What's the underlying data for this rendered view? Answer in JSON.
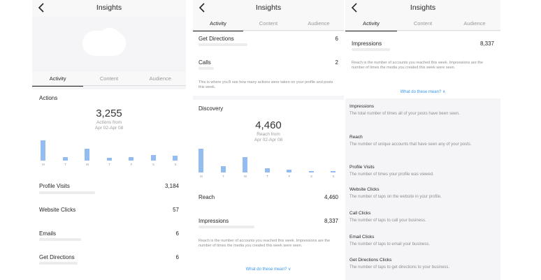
{
  "title": "Insights",
  "tabs": [
    "Activity",
    "Content",
    "Audience"
  ],
  "panel1": {
    "actions_heading": "Actions",
    "total": "3,255",
    "total_caption": "Actions from",
    "total_range": "Apr 02-Apr 08",
    "days": [
      "M",
      "T",
      "W",
      "T",
      "F",
      "S",
      "S"
    ],
    "bar_values": [
      0.95,
      0.15,
      0.55,
      0.13,
      0.16,
      0.28,
      0.23
    ],
    "rows": [
      {
        "label": "Profile Visits",
        "value": "3,184"
      },
      {
        "label": "Website Clicks",
        "value": "57"
      },
      {
        "label": "Emails",
        "value": "6"
      },
      {
        "label": "Get Directions",
        "value": "6"
      }
    ]
  },
  "panel2": {
    "rows_top": [
      {
        "label": "Get Directions",
        "value": "6"
      },
      {
        "label": "Calls",
        "value": "2"
      }
    ],
    "note": "This is where you'll see how many actions were taken on your profile and posts this week.",
    "discovery_heading": "Discovery",
    "total": "4,460",
    "total_caption": "Reach from",
    "total_range": "Apr 02-Apr 08",
    "days": [
      "M",
      "T",
      "W",
      "T",
      "F",
      "S",
      "S"
    ],
    "bar_values": [
      1.0,
      0.27,
      0.66,
      0.18,
      0.12,
      0.07,
      0.06
    ],
    "reach_label": "Reach",
    "reach_value": "4,460",
    "impressions_label": "Impressions",
    "impressions_value": "8,337",
    "footnote": "Reach is the number of accounts you reached this week. Impressions are the number of times the media you created this week were seen.",
    "link": "What do these mean? ∨"
  },
  "panel3": {
    "impressions_label": "Impressions",
    "impressions_value": "8,337",
    "footnote": "Reach is the number of accounts you reached this week. Impressions are the number of times the media you created this week were seen.",
    "link": "What do these mean? ∧",
    "definitions": [
      {
        "term": "Impressions",
        "desc": "The total number of times all of your posts have been seen."
      },
      {
        "term": "Reach",
        "desc": "The number of unique accounts that have seen any of your posts."
      },
      {
        "term": "Profile Visits",
        "desc": "The number of times your profile was viewed."
      },
      {
        "term": "Website Clicks",
        "desc": "The number of taps on the website in your profile."
      },
      {
        "term": "Call Clicks",
        "desc": "The number of taps to call your business."
      },
      {
        "term": "Email Clicks",
        "desc": "The number of taps to email your business."
      },
      {
        "term": "Get Directions Clicks",
        "desc": "The number of taps to get directions to your business."
      }
    ]
  }
}
